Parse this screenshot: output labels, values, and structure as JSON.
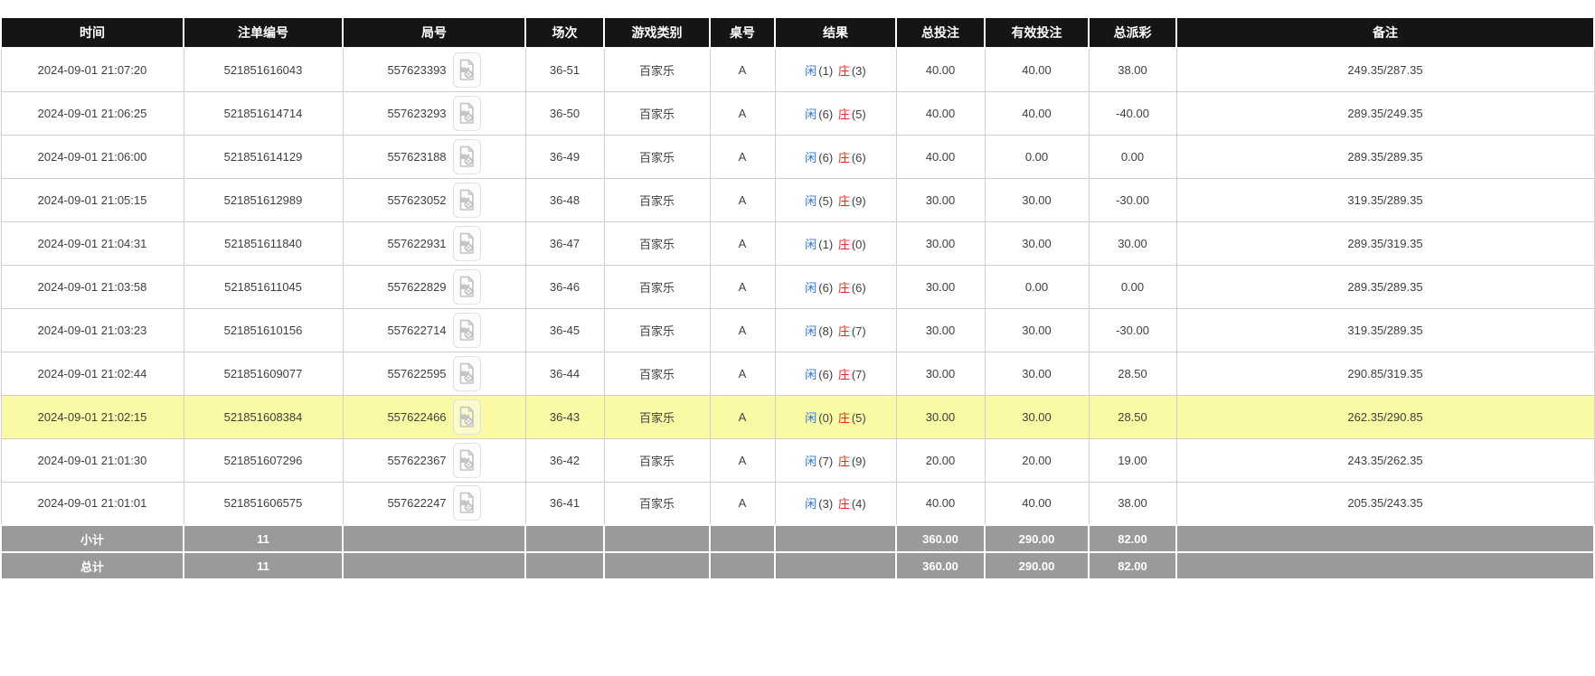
{
  "table": {
    "columns": [
      {
        "label": "时间"
      },
      {
        "label": "注单编号"
      },
      {
        "label": "局号"
      },
      {
        "label": "场次"
      },
      {
        "label": "游戏类别"
      },
      {
        "label": "桌号"
      },
      {
        "label": "结果"
      },
      {
        "label": "总投注"
      },
      {
        "label": "有效投注"
      },
      {
        "label": "总派彩"
      },
      {
        "label": "备注"
      }
    ],
    "highlighted_row_index": 8,
    "rows": [
      {
        "time": "2024-09-01 21:07:20",
        "bet_id": "521851616043",
        "round": "557623393",
        "session": "36-51",
        "game_type": "百家乐",
        "table_no": "A",
        "result": {
          "player_label": "闲",
          "player_score": "(1)",
          "banker_label": "庄",
          "banker_score": "(3)"
        },
        "total_bet": "40.00",
        "valid_bet": "40.00",
        "total_payout": "38.00",
        "remark": "249.35/287.35"
      },
      {
        "time": "2024-09-01 21:06:25",
        "bet_id": "521851614714",
        "round": "557623293",
        "session": "36-50",
        "game_type": "百家乐",
        "table_no": "A",
        "result": {
          "player_label": "闲",
          "player_score": "(6)",
          "banker_label": "庄",
          "banker_score": "(5)"
        },
        "total_bet": "40.00",
        "valid_bet": "40.00",
        "total_payout": "-40.00",
        "remark": "289.35/249.35"
      },
      {
        "time": "2024-09-01 21:06:00",
        "bet_id": "521851614129",
        "round": "557623188",
        "session": "36-49",
        "game_type": "百家乐",
        "table_no": "A",
        "result": {
          "player_label": "闲",
          "player_score": "(6)",
          "banker_label": "庄",
          "banker_score": "(6)"
        },
        "total_bet": "40.00",
        "valid_bet": "0.00",
        "total_payout": "0.00",
        "remark": "289.35/289.35"
      },
      {
        "time": "2024-09-01 21:05:15",
        "bet_id": "521851612989",
        "round": "557623052",
        "session": "36-48",
        "game_type": "百家乐",
        "table_no": "A",
        "result": {
          "player_label": "闲",
          "player_score": "(5)",
          "banker_label": "庄",
          "banker_score": "(9)"
        },
        "total_bet": "30.00",
        "valid_bet": "30.00",
        "total_payout": "-30.00",
        "remark": "319.35/289.35"
      },
      {
        "time": "2024-09-01 21:04:31",
        "bet_id": "521851611840",
        "round": "557622931",
        "session": "36-47",
        "game_type": "百家乐",
        "table_no": "A",
        "result": {
          "player_label": "闲",
          "player_score": "(1)",
          "banker_label": "庄",
          "banker_score": "(0)"
        },
        "total_bet": "30.00",
        "valid_bet": "30.00",
        "total_payout": "30.00",
        "remark": "289.35/319.35"
      },
      {
        "time": "2024-09-01 21:03:58",
        "bet_id": "521851611045",
        "round": "557622829",
        "session": "36-46",
        "game_type": "百家乐",
        "table_no": "A",
        "result": {
          "player_label": "闲",
          "player_score": "(6)",
          "banker_label": "庄",
          "banker_score": "(6)"
        },
        "total_bet": "30.00",
        "valid_bet": "0.00",
        "total_payout": "0.00",
        "remark": "289.35/289.35"
      },
      {
        "time": "2024-09-01 21:03:23",
        "bet_id": "521851610156",
        "round": "557622714",
        "session": "36-45",
        "game_type": "百家乐",
        "table_no": "A",
        "result": {
          "player_label": "闲",
          "player_score": "(8)",
          "banker_label": "庄",
          "banker_score": "(7)"
        },
        "total_bet": "30.00",
        "valid_bet": "30.00",
        "total_payout": "-30.00",
        "remark": "319.35/289.35"
      },
      {
        "time": "2024-09-01 21:02:44",
        "bet_id": "521851609077",
        "round": "557622595",
        "session": "36-44",
        "game_type": "百家乐",
        "table_no": "A",
        "result": {
          "player_label": "闲",
          "player_score": "(6)",
          "banker_label": "庄",
          "banker_score": "(7)"
        },
        "total_bet": "30.00",
        "valid_bet": "30.00",
        "total_payout": "28.50",
        "remark": "290.85/319.35"
      },
      {
        "time": "2024-09-01 21:02:15",
        "bet_id": "521851608384",
        "round": "557622466",
        "session": "36-43",
        "game_type": "百家乐",
        "table_no": "A",
        "result": {
          "player_label": "闲",
          "player_score": "(0)",
          "banker_label": "庄",
          "banker_score": "(5)"
        },
        "total_bet": "30.00",
        "valid_bet": "30.00",
        "total_payout": "28.50",
        "remark": "262.35/290.85"
      },
      {
        "time": "2024-09-01 21:01:30",
        "bet_id": "521851607296",
        "round": "557622367",
        "session": "36-42",
        "game_type": "百家乐",
        "table_no": "A",
        "result": {
          "player_label": "闲",
          "player_score": "(7)",
          "banker_label": "庄",
          "banker_score": "(9)"
        },
        "total_bet": "20.00",
        "valid_bet": "20.00",
        "total_payout": "19.00",
        "remark": "243.35/262.35"
      },
      {
        "time": "2024-09-01 21:01:01",
        "bet_id": "521851606575",
        "round": "557622247",
        "session": "36-41",
        "game_type": "百家乐",
        "table_no": "A",
        "result": {
          "player_label": "闲",
          "player_score": "(3)",
          "banker_label": "庄",
          "banker_score": "(4)"
        },
        "total_bet": "40.00",
        "valid_bet": "40.00",
        "total_payout": "38.00",
        "remark": "205.35/243.35"
      }
    ],
    "subtotal": {
      "label": "小计",
      "count": "11",
      "total_bet": "360.00",
      "valid_bet": "290.00",
      "total_payout": "82.00"
    },
    "total": {
      "label": "总计",
      "count": "11",
      "total_bet": "360.00",
      "valid_bet": "290.00",
      "total_payout": "82.00"
    }
  },
  "icons": {
    "round_video": "video-replay-icon"
  },
  "colors": {
    "header_bg": "#151515",
    "summary_bg": "#9a9a9a",
    "border": "#cfcfcf",
    "text": "#3f3f3f",
    "blue": "#2a72e8",
    "red": "#ee2318",
    "row_highlight": "#fafaa4"
  }
}
